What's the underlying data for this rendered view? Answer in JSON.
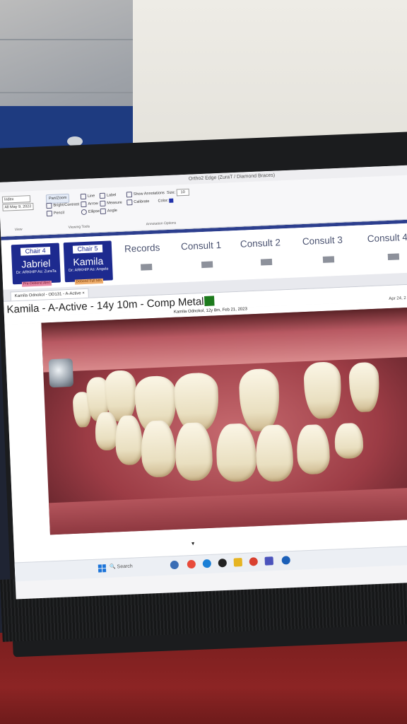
{
  "window": {
    "title": "Ortho2 Edge (ZuraT / Diamond Braces)"
  },
  "ribbon": {
    "left_input": "Index",
    "date_input": "All  May 9, 2022",
    "view_caption": "View",
    "tools": {
      "pan_zoom": "Pan/Zoom",
      "bright_contrast": "Bright/Contrast",
      "pencil": "Pencil",
      "line": "Line",
      "arrow": "Arrow",
      "ellipse": "Ellipse",
      "label": "Label",
      "measure": "Measure",
      "angle": "Angle",
      "caption": "Viewing Tools"
    },
    "annotation": {
      "show_annotations": "Show Annotations",
      "calibrate": "Calibrate",
      "size_label": "Size:",
      "size_value": "10",
      "color_label": "Color:",
      "caption": "Annotation Options"
    }
  },
  "chairs": [
    {
      "chair": "Chair 4",
      "patient": "Jabriel",
      "providers": "Dr: ARKHIP  As: ZuraTa",
      "status": "Pre-Debond Alert",
      "status_color": "#e88aa6"
    },
    {
      "chair": "Chair 5",
      "patient": "Kamila",
      "providers": "Dr: ARKHIP  As: Angele",
      "status": "Debond Full Mth",
      "status_color": "#f0b070"
    }
  ],
  "nav_tabs": [
    "Records",
    "Consult 1",
    "Consult 2",
    "Consult 3",
    "Consult 4"
  ],
  "doc_tab": "Kamila Odnokol - OD131 - A-Active ×",
  "patient_header": "Kamila - A-Active - 14y 10m - Comp Metal",
  "accent_color": "#1c7a1c",
  "image_caption": "Kamila Odnokol, 12y 8m, Feb 21, 2023",
  "image_date": "Apr 24, 2",
  "taskbar": {
    "search": "Search"
  }
}
